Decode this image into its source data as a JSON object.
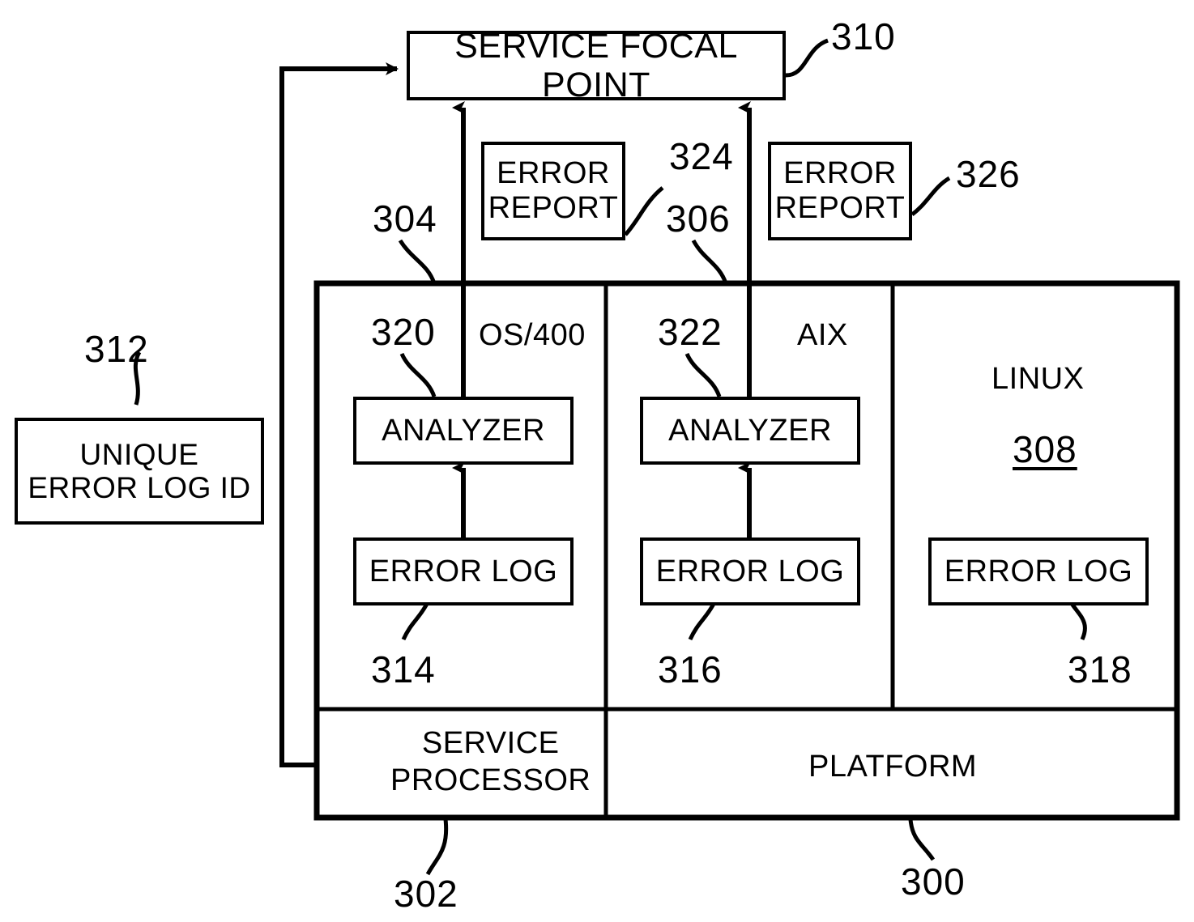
{
  "figure": {
    "title": "Error log reporting architecture block diagram",
    "stroke_color": "#000000",
    "background_color": "#ffffff"
  },
  "boxes": {
    "service_focal_point": {
      "label": "SERVICE FOCAL POINT",
      "ref": "310"
    },
    "error_report_left": {
      "label_line1": "ERROR",
      "label_line2": "REPORT",
      "ref": "324"
    },
    "error_report_right": {
      "label_line1": "ERROR",
      "label_line2": "REPORT",
      "ref": "326"
    },
    "unique_error_log_id": {
      "label_line1": "UNIQUE",
      "label_line2": "ERROR LOG ID",
      "ref": "312"
    },
    "analyzer_os400": {
      "label": "ANALYZER",
      "ref": "320"
    },
    "analyzer_aix": {
      "label": "ANALYZER",
      "ref": "322"
    },
    "error_log_os400": {
      "label": "ERROR LOG",
      "ref": "314"
    },
    "error_log_aix": {
      "label": "ERROR LOG",
      "ref": "316"
    },
    "error_log_linux": {
      "label": "ERROR LOG",
      "ref": "318"
    }
  },
  "partitions": {
    "os400": {
      "name": "OS/400",
      "ref": "304"
    },
    "aix": {
      "name": "AIX",
      "ref": "306"
    },
    "linux": {
      "name": "LINUX",
      "ref": "308"
    }
  },
  "bands": {
    "service_processor": {
      "label_line1": "SERVICE",
      "label_line2": "PROCESSOR",
      "ref": "302"
    },
    "platform": {
      "label": "PLATFORM",
      "ref": "300"
    }
  }
}
